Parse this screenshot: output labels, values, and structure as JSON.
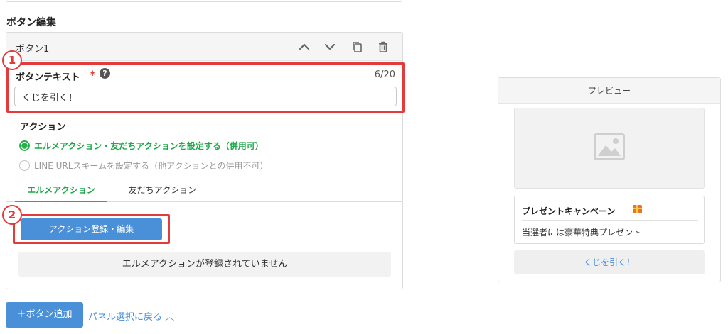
{
  "editor": {
    "section_title": "ボタン編集",
    "button_name": "ボタン1",
    "field_label": "ボタンテキスト",
    "required_mark": "*",
    "help_mark": "?",
    "counter": "6/20",
    "input_value": "くじを引く！",
    "action_label": "アクション",
    "radio_options": [
      {
        "label": "エルメアクション・友だちアクションを設定する（併用可）",
        "selected": true
      },
      {
        "label": "LINE URLスキームを設定する（他アクションとの併用不可）",
        "selected": false
      }
    ],
    "tabs": [
      {
        "label": "エルメアクション",
        "active": true
      },
      {
        "label": "友だちアクション",
        "active": false
      }
    ],
    "action_button_label": "アクション登録・編集",
    "notice_text": "エルメアクションが登録されていません",
    "header_icons": [
      "chevron-up-icon",
      "chevron-down-icon",
      "copy-icon",
      "trash-icon"
    ]
  },
  "annotations": {
    "badge_1": "1",
    "badge_2": "2"
  },
  "footer": {
    "add_button_label": "＋ボタン追加",
    "back_link_label": "パネル選択に戻る ︿"
  },
  "preview": {
    "header": "プレビュー",
    "card_title": "プレゼントキャンペーン",
    "card_body": "当選者には豪華特典プレゼント",
    "button_label": "くじを引く！"
  },
  "colors": {
    "accent_green": "#26b24a",
    "primary_blue": "#4a90d9",
    "highlight_red": "#e33b3b"
  }
}
